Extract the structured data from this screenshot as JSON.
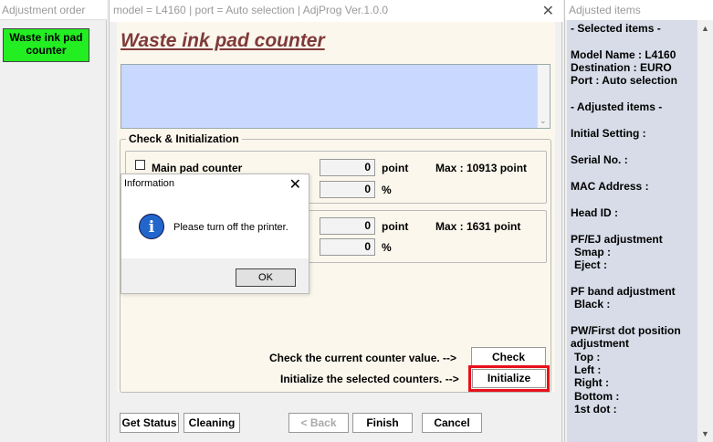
{
  "left_window": {
    "title": "Adjustment order",
    "button_label_line1": "Waste ink pad",
    "button_label_line2": "counter"
  },
  "main_window": {
    "title": "model = L4160 | port = Auto selection | AdjProg Ver.1.0.0",
    "page_title": "Waste ink pad counter",
    "check_group_label": "Check & Initialization",
    "main_pad": {
      "label": "Main pad counter",
      "checked": false,
      "point_value": "0",
      "point_unit": "point",
      "max_text": "Max : 10913 point",
      "percent_value": "0",
      "percent_unit": "%"
    },
    "second_pad": {
      "point_value": "0",
      "point_unit": "point",
      "max_text": "Max : 1631 point",
      "percent_value": "0",
      "percent_unit": "%"
    },
    "check_prompt": "Check the current counter value. -->",
    "check_button": "Check",
    "init_prompt": "Initialize the selected counters. -->",
    "init_button": "Initialize",
    "highlight_color": "#e8101c",
    "bottom_buttons": {
      "get_status": "Get Status",
      "cleaning": "Cleaning",
      "back": "< Back",
      "finish": "Finish",
      "cancel": "Cancel"
    }
  },
  "dialog": {
    "title": "Information",
    "message": "Please turn off the printer.",
    "ok": "OK",
    "icon": "info-icon"
  },
  "right_window": {
    "title": "Adjusted items",
    "lines": [
      "- Selected items -",
      "Model Name : L4160",
      "Destination : EURO",
      "Port : Auto selection",
      "- Adjusted items -",
      "Initial Setting :",
      "Serial No. :",
      "MAC Address :",
      "Head ID :",
      "PF/EJ adjustment",
      "Smap :",
      "Eject :",
      "PF band adjustment",
      "Black :",
      "PW/First dot position",
      "adjustment",
      "Top :",
      "Left :",
      "Right :",
      "Bottom :",
      "1st dot :"
    ]
  }
}
